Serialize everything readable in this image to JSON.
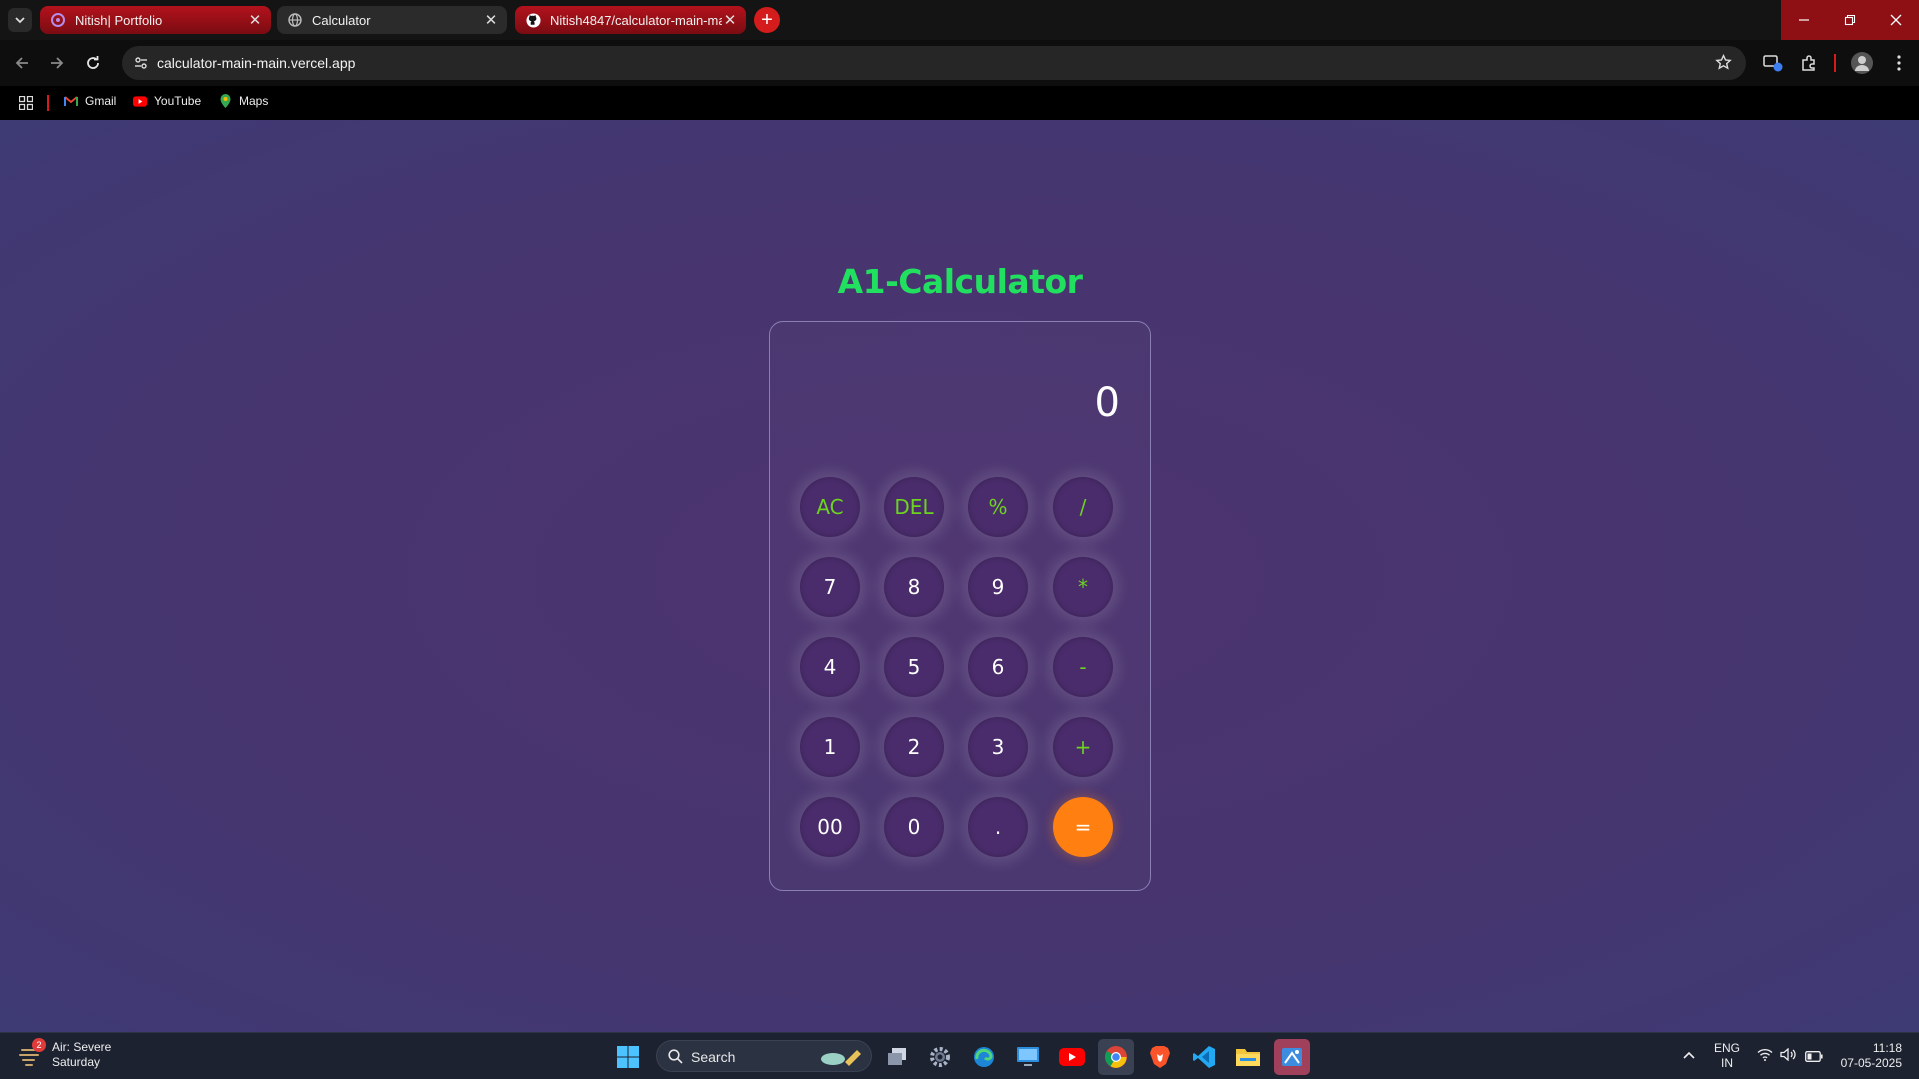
{
  "browser": {
    "tabs": [
      {
        "title": "Nitish| Portfolio",
        "active": false
      },
      {
        "title": "Calculator",
        "active": true
      },
      {
        "title": "Nitish4847/calculator-main-ma",
        "active": false
      }
    ],
    "url": "calculator-main-main.vercel.app",
    "bookmarks": [
      {
        "label": "Gmail",
        "icon": "gmail-icon"
      },
      {
        "label": "YouTube",
        "icon": "youtube-icon"
      },
      {
        "label": "Maps",
        "icon": "maps-icon"
      }
    ]
  },
  "app": {
    "title": "A1-Calculator",
    "display": "0",
    "keys": [
      [
        "AC",
        "DEL",
        "%",
        "/"
      ],
      [
        "7",
        "8",
        "9",
        "*"
      ],
      [
        "4",
        "5",
        "6",
        "-"
      ],
      [
        "1",
        "2",
        "3",
        "+"
      ],
      [
        "00",
        "0",
        ".",
        "="
      ]
    ],
    "colors": {
      "title": "#22e05f",
      "operator": "#6cd41f",
      "equals": "#ff7f11",
      "key_bg": "#4a2c6c"
    }
  },
  "taskbar": {
    "weather_title": "Air: Severe",
    "weather_sub": "Saturday",
    "weather_badge": "2",
    "search_label": "Search",
    "lang_top": "ENG",
    "lang_bottom": "IN",
    "time": "11:18",
    "date": "07-05-2025"
  }
}
